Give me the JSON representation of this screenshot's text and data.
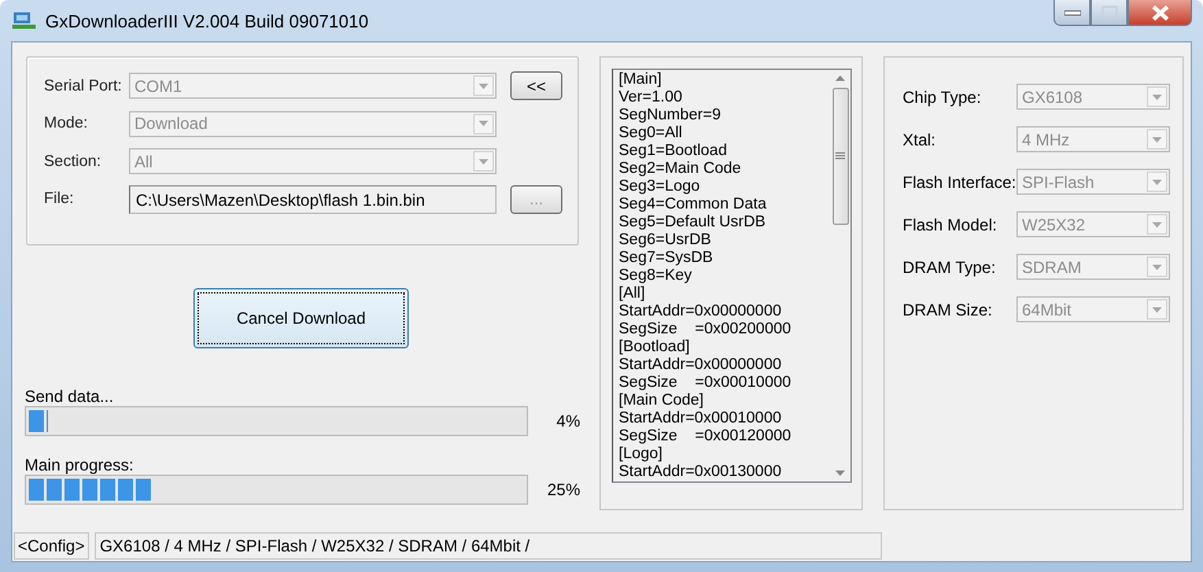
{
  "window": {
    "title": "GxDownloaderIII V2.004 Build 09071010"
  },
  "source": {
    "fields": [
      {
        "label": "Serial Port:",
        "kind": "combo",
        "value": "COM1",
        "disabled": true,
        "button": {
          "label": "<<",
          "disabled": false
        }
      },
      {
        "label": "Mode:",
        "kind": "combo",
        "value": "Download",
        "disabled": true
      },
      {
        "label": "Section:",
        "kind": "combo",
        "value": "All",
        "disabled": true
      },
      {
        "label": "File:",
        "kind": "text",
        "value": "C:\\Users\\Mazen\\Desktop\\flash 1.bin.bin",
        "disabled": false,
        "button": {
          "label": "...",
          "disabled": true
        }
      }
    ]
  },
  "action_button": {
    "label": "Cancel Download"
  },
  "progress": [
    {
      "label": "Send data...",
      "level": 0.04,
      "reading": "4%"
    },
    {
      "label": "Main progress:",
      "level": 0.25,
      "reading": "25%"
    }
  ],
  "segment_list": {
    "lines": [
      "[Main]",
      "Ver=1.00",
      "SegNumber=9",
      "Seg0=All",
      "Seg1=Bootload",
      "Seg2=Main Code",
      "Seg3=Logo",
      "Seg4=Common Data",
      "Seg5=Default UsrDB",
      "Seg6=UsrDB",
      "Seg7=SysDB",
      "Seg8=Key",
      "[All]",
      "StartAddr=0x00000000",
      "SegSize    =0x00200000",
      "[Bootload]",
      "StartAddr=0x00000000",
      "SegSize    =0x00010000",
      "[Main Code]",
      "StartAddr=0x00010000",
      "SegSize    =0x00120000",
      "[Logo]",
      "StartAddr=0x00130000"
    ]
  },
  "chip": {
    "fields": [
      {
        "label": "Chip Type:",
        "value": "GX6108",
        "disabled": true
      },
      {
        "label": "Xtal:",
        "value": "4 MHz",
        "disabled": true
      },
      {
        "label": "Flash Interface:",
        "value": "SPI-Flash",
        "disabled": true
      },
      {
        "label": "Flash Model:",
        "value": "W25X32",
        "disabled": true
      },
      {
        "label": "DRAM Type:",
        "value": "SDRAM",
        "disabled": true
      },
      {
        "label": "DRAM Size:",
        "value": "64Mbit",
        "disabled": true
      }
    ]
  },
  "status_bar": {
    "tag": "<Config>",
    "text": "GX6108 / 4 MHz / SPI-Flash / W25X32 / SDRAM / 64Mbit /"
  }
}
